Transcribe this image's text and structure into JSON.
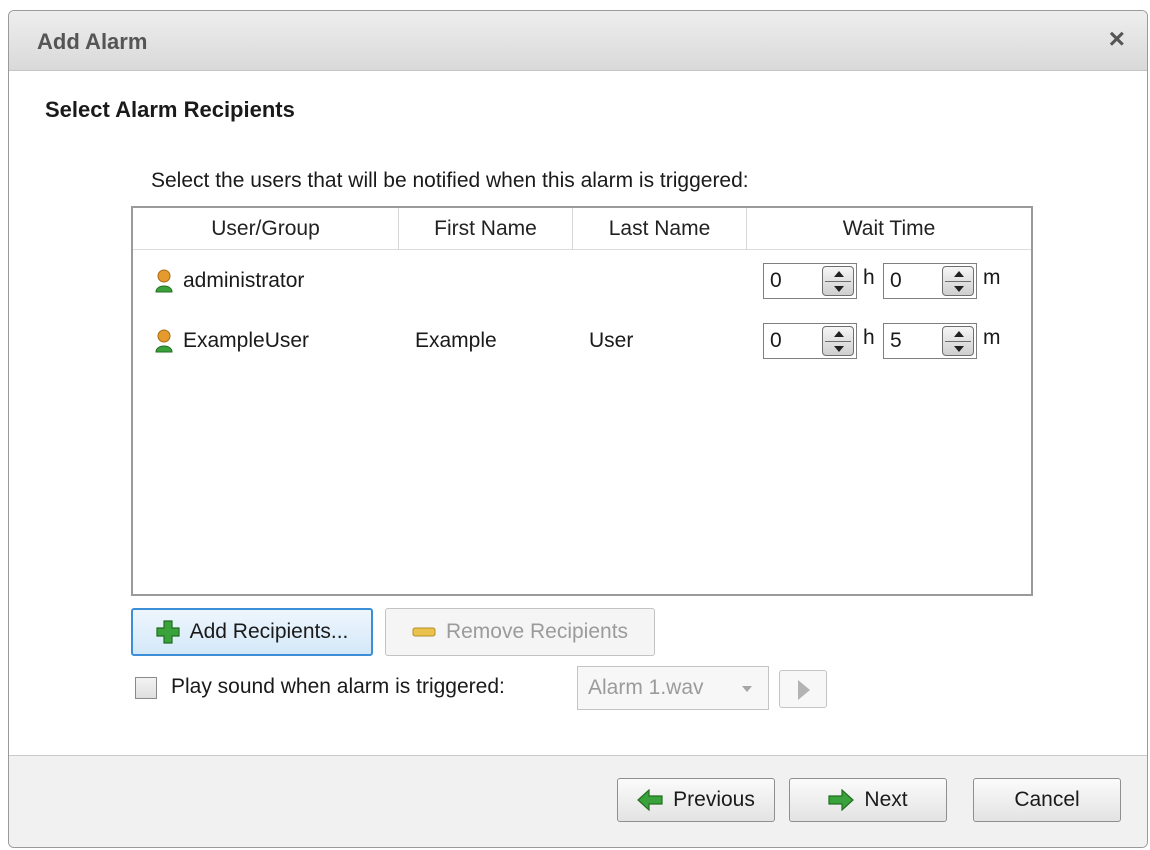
{
  "dialog": {
    "title": "Add Alarm",
    "close_label": "×"
  },
  "section_title": "Select Alarm Recipients",
  "instruction": "Select the users that will be notified when this alarm is triggered:",
  "table": {
    "columns": [
      "User/Group",
      "First Name",
      "Last Name",
      "Wait Time"
    ],
    "rows": [
      {
        "user": "administrator",
        "first_name": "",
        "last_name": "",
        "hours": "0",
        "minutes": "0",
        "hour_unit": "h",
        "minute_unit": "m"
      },
      {
        "user": "ExampleUser",
        "first_name": "Example",
        "last_name": "User",
        "hours": "0",
        "minutes": "5",
        "hour_unit": "h",
        "minute_unit": "m"
      }
    ]
  },
  "actions": {
    "add_recipients": "Add Recipients...",
    "remove_recipients": "Remove Recipients"
  },
  "sound": {
    "label": "Play sound when alarm is triggered:",
    "selected": "Alarm 1.wav",
    "checked": false
  },
  "footer": {
    "previous": "Previous",
    "next": "Next",
    "cancel": "Cancel"
  },
  "colors": {
    "accent_green": "#3aa23a",
    "user_icon_orange": "#e59a2e",
    "focus_blue": "#3c8fd6"
  }
}
